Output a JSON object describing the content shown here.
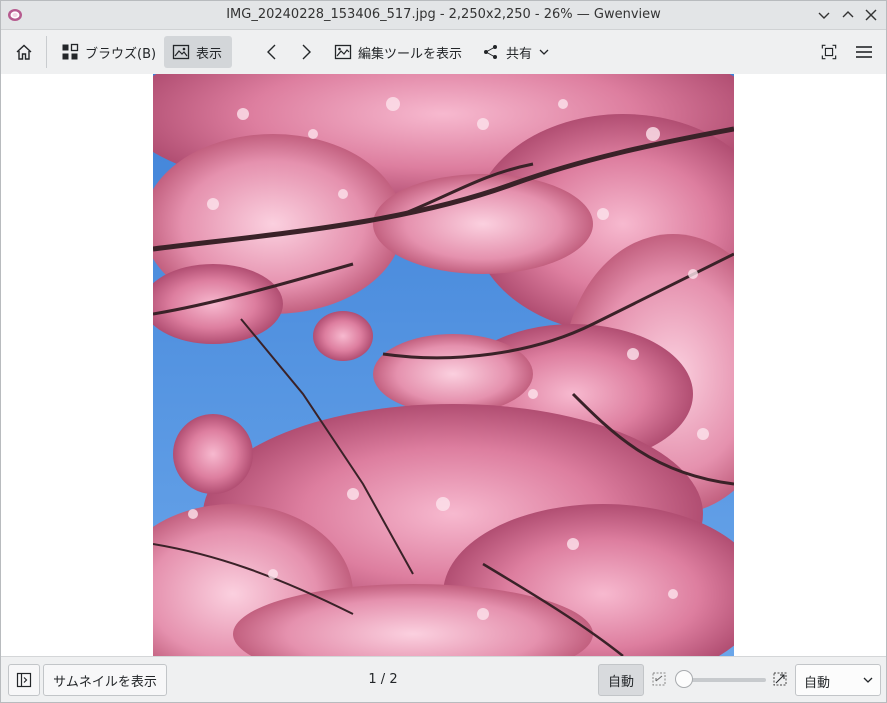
{
  "window": {
    "title": "IMG_20240228_153406_517.jpg - 2,250x2,250 - 26% — Gwenview",
    "accent_color": "#b65b8f"
  },
  "toolbar": {
    "browse_label": "ブラウズ(B)",
    "view_label": "表示",
    "edit_tools_label": "編集ツールを表示",
    "share_label": "共有"
  },
  "viewer": {
    "image_description": "cherry-blossom-photo"
  },
  "statusbar": {
    "thumbnails_label": "サムネイルを表示",
    "page_indicator": "1 / 2",
    "zoom_auto_label": "自動",
    "zoom_combo_value": "自動",
    "zoom_percent_shown": 26
  }
}
